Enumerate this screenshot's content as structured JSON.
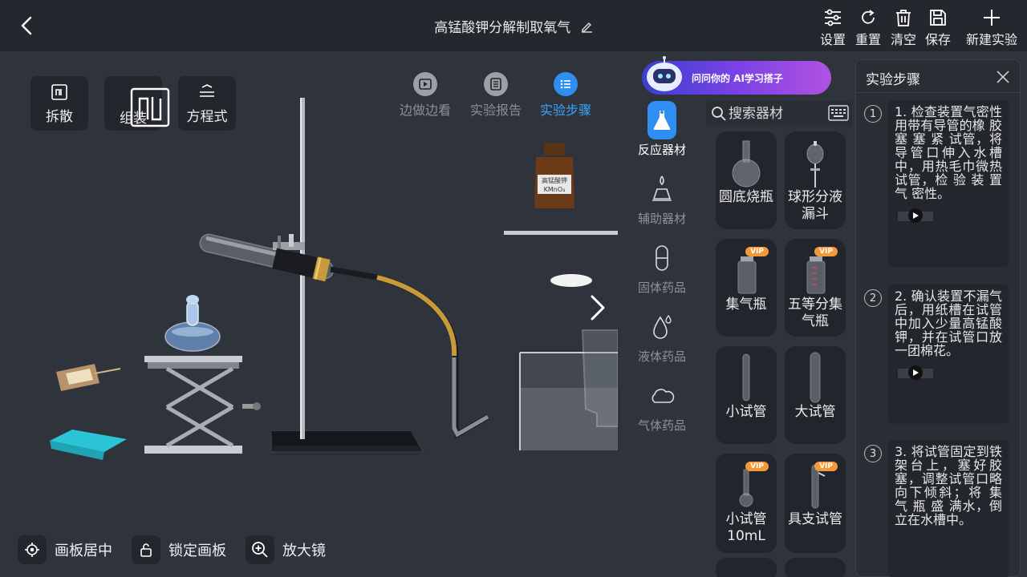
{
  "header": {
    "title": "高锰酸钾分解制取氧气",
    "buttons": [
      {
        "label": "设置",
        "icon": "sliders-icon"
      },
      {
        "label": "重置",
        "icon": "refresh-icon"
      },
      {
        "label": "清空",
        "icon": "trash-icon"
      },
      {
        "label": "保存",
        "icon": "save-icon"
      },
      {
        "label": "新建实验",
        "icon": "plus-icon"
      }
    ]
  },
  "tools": [
    {
      "label": "拆散"
    },
    {
      "label": "组装"
    },
    {
      "label": "方程式"
    }
  ],
  "modes": [
    {
      "label": "边做边看",
      "active": false
    },
    {
      "label": "实验报告",
      "active": false
    },
    {
      "label": "实验步骤",
      "active": true
    }
  ],
  "canvas": {
    "bottle_label_name": "高锰酸钾",
    "bottle_label_formula": "KMnO₄"
  },
  "ai_banner": {
    "text": "问问你的 AI学习搭子"
  },
  "categories": [
    {
      "label": "反应器材",
      "active": true
    },
    {
      "label": "辅助器材",
      "active": false
    },
    {
      "label": "固体药品",
      "active": false
    },
    {
      "label": "液体药品",
      "active": false
    },
    {
      "label": "气体药品",
      "active": false
    }
  ],
  "search": {
    "placeholder": "搜索器材"
  },
  "equipment": [
    {
      "label": "圆底烧瓶",
      "vip": false
    },
    {
      "label": "球形分液漏斗",
      "vip": false
    },
    {
      "label": "集气瓶",
      "vip": true
    },
    {
      "label": "五等分集气瓶",
      "vip": true
    },
    {
      "label": "小试管",
      "vip": false
    },
    {
      "label": "大试管",
      "vip": false
    },
    {
      "label": "小试管10mL",
      "vip": true
    },
    {
      "label": "具支试管",
      "vip": true
    }
  ],
  "vip_badge": "VIP",
  "steps_panel": {
    "title": "实验步骤",
    "steps": [
      {
        "num": "1",
        "text": "1. 检查装置气密性 用带有导管的橡 胶 塞 塞 紧 试管，将导管口伸入水槽中，用热毛巾微热试管，检 验 装 置 气 密性。"
      },
      {
        "num": "2",
        "text": "2. 确认装置不漏气后，用纸槽在试管中加入少量高锰酸钾，并在试管口放一团棉花。"
      },
      {
        "num": "3",
        "text": "3. 将试管固定到铁架台上，塞好胶塞，调整试管口略向下倾斜；将 集 气 瓶 盛 满水，倒立在水槽中。"
      }
    ]
  },
  "bottom_controls": [
    {
      "label": "画板居中"
    },
    {
      "label": "锁定画板"
    },
    {
      "label": "放大镜"
    }
  ],
  "colors": {
    "accent": "#2e8ff0",
    "active_text": "#3aa6ff",
    "vip": "#f29a3b",
    "background": "#2f333b",
    "topbar": "#24272e"
  }
}
